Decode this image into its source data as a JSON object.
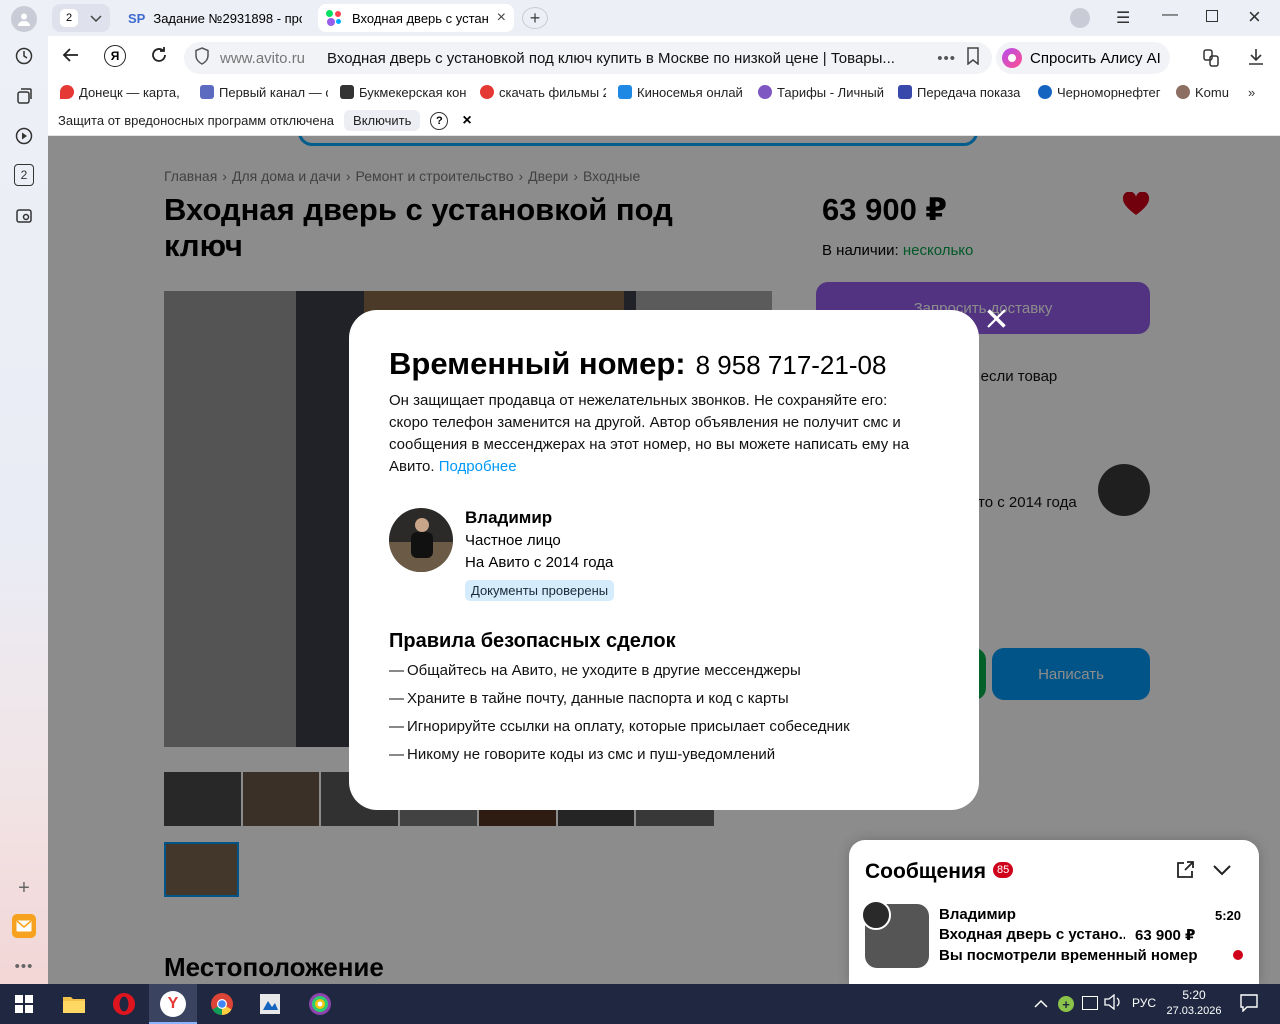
{
  "browser": {
    "tab_counter": "2",
    "tabs": [
      {
        "prefix": "SP",
        "title": "Задание №2931898 - про"
      },
      {
        "title": "Входная дверь с устан"
      }
    ],
    "url_domain": "www.avito.ru",
    "url_title": "Входная дверь с установкой под ключ купить в Москве по низкой цене | Товары...",
    "alice_label": "Спросить Алису AI",
    "left_tab_count": "2",
    "bookmarks": [
      {
        "label": "Донецк — карта, ",
        "color": "#e53935"
      },
      {
        "label": "Первый канал — с",
        "color": "#5c6bc0"
      },
      {
        "label": "Букмекерская кон",
        "color": "#333333"
      },
      {
        "label": "скачать фильмы 2",
        "color": "#e53935"
      },
      {
        "label": "Киносемья онлай",
        "color": "#1e88e5"
      },
      {
        "label": "Тарифы - Личный",
        "color": "#7e57c2"
      },
      {
        "label": "Передача показа",
        "color": "#3949ab"
      },
      {
        "label": "Черноморнефтег",
        "color": "#1565c0"
      },
      {
        "label": "Komu",
        "color": "#8d6e63"
      }
    ],
    "infobar_text": "Защита от вредоносных программ отключена",
    "infobar_button": "Включить",
    "infobar_help": "?",
    "infobar_close": "×"
  },
  "page": {
    "breadcrumbs": [
      "Главная",
      "Для дома и дачи",
      "Ремонт и строительство",
      "Двери",
      "Входные"
    ],
    "title": "Входная дверь с установкой под ключ",
    "price": "63 900 ₽",
    "availability_label": "В наличии:",
    "availability_value": "несколько",
    "delivery_button": "Запросить доставку",
    "partial_text_1": "нег, если товар",
    "partial_text_2": "то с 2014 года",
    "write_button": "Написать",
    "location_heading": "Местоположение",
    "accent_color": "#965eeb",
    "heart_color": "#d0021b"
  },
  "messages": {
    "title": "Сообщения",
    "badge": "85",
    "name": "Владимир",
    "time": "5:20",
    "item": "Входная дверь с устано...",
    "price": "63 900 ₽",
    "note": "Вы посмотрели временный номер"
  },
  "modal": {
    "title": "Временный номер:",
    "phone": "8 958 717-21-08",
    "description": "Он защищает продавца от нежелательных звонков. Не сохраняйте его: скоро телефон заменится на другой. Автор объявления не получит смс и сообщения в мессенджерах на этот номер, но вы можете написать ему на Авито.",
    "more_link": "Подробнее",
    "seller_name": "Владимир",
    "seller_type": "Частное лицо",
    "seller_since": "На Авито с 2014 года",
    "docs_badge": "Документы проверены",
    "rules_title": "Правила безопасных сделок",
    "rules": [
      "Общайтесь на Авито, не уходите в другие мессенджеры",
      "Храните в тайне почту, данные паспорта и код с карты",
      "Игнорируйте ссылки на оплату, которые присылает собеседник",
      "Никому не говорите коды из смс и пуш-уведомлений"
    ],
    "link_color": "#0099f7"
  },
  "taskbar": {
    "lang": "РУС",
    "time": "5:20",
    "date": "27.03.2026"
  }
}
